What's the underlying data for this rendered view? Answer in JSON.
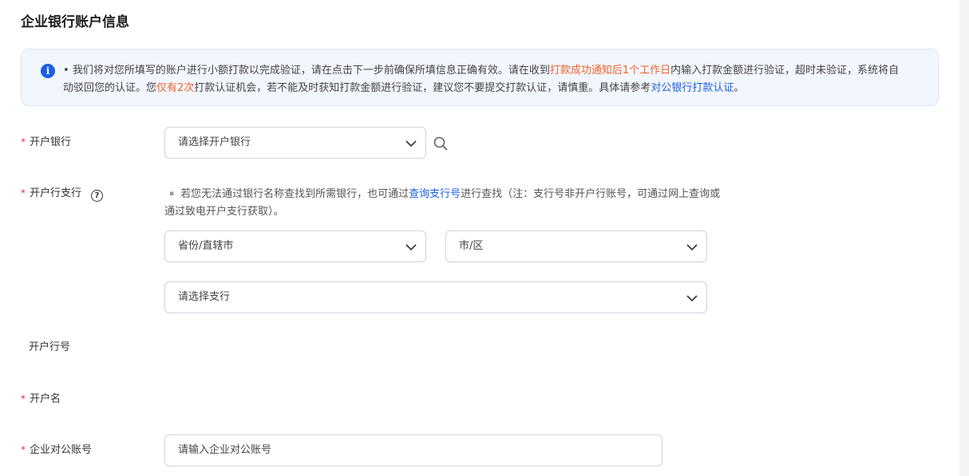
{
  "page": {
    "title": "企业银行账户信息"
  },
  "notice": {
    "bullet": "•",
    "part1": "我们将对您所填写的账户进行小额打款以完成验证，请在点击下一步前确保所填信息正确有效。请在收到",
    "highlight1": "打款成功通知后1个工作日",
    "part2": "内输入打款金额进行验证，超时未验证，系统将自动驳回您的认证。您",
    "highlight2": "仅有2次",
    "part3": "打款认证机会，若不能及时获知打款金额进行验证，建议您不要提交打款认证，请慎重。具体请参考",
    "link": "对公银行打款认证",
    "end": "。"
  },
  "form": {
    "required_mark": "*",
    "bank": {
      "label": "开户银行",
      "placeholder": "请选择开户银行"
    },
    "branch": {
      "label": "开户行支行",
      "help": "?",
      "hint_bullet": "▪",
      "hint_part1": "若您无法通过银行名称查找到所需银行，也可通过",
      "hint_link": "查询支行号",
      "hint_part2": "进行查找（注：支行号非开户行账号，可通过网上查询或通过致电开户支行获取）。",
      "province_placeholder": "省份/直辖市",
      "city_placeholder": "市/区",
      "branch_placeholder": "请选择支行"
    },
    "bank_code": {
      "label": "开户行号"
    },
    "account_name": {
      "label": "开户名"
    },
    "account_number": {
      "label": "企业对公账号",
      "placeholder": "请输入企业对公账号"
    }
  },
  "colors": {
    "accent": "#1a5fe6",
    "warning": "#f0622a",
    "required": "#e5333b"
  },
  "icons": {
    "notice": "info-icon",
    "search": "search-icon",
    "dropdown": "chevron-down-icon",
    "help": "help-circle-icon"
  }
}
